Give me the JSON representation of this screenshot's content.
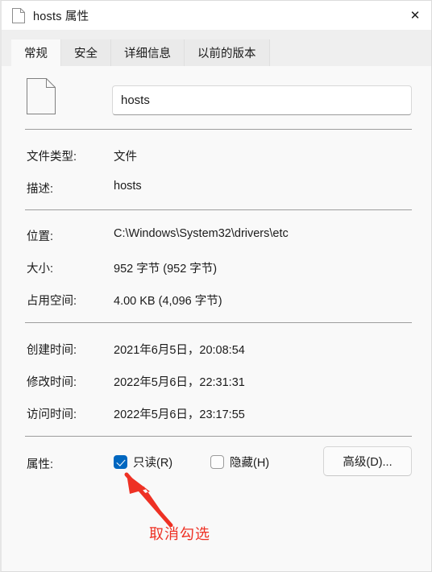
{
  "window": {
    "title": "hosts 属性",
    "title_icon": "file-icon",
    "close_label": "✕",
    "accent_color": "#0067c0",
    "annotation_color": "#ee3124"
  },
  "tabs": [
    {
      "label": "常规",
      "active": true
    },
    {
      "label": "安全",
      "active": false
    },
    {
      "label": "详细信息",
      "active": false
    },
    {
      "label": "以前的版本",
      "active": false
    }
  ],
  "general": {
    "file_icon": "file-icon",
    "name_value": "hosts",
    "name_placeholder": "",
    "rows": [
      {
        "label": "文件类型:",
        "value": "文件"
      },
      {
        "label": "描述:",
        "value": "hosts"
      },
      {
        "label": "位置:",
        "value": "C:\\Windows\\System32\\drivers\\etc"
      },
      {
        "label": "大小:",
        "value": "952 字节 (952 字节)"
      },
      {
        "label": "占用空间:",
        "value": "4.00 KB (4,096 字节)"
      },
      {
        "label": "创建时间:",
        "value": "2021年6月5日，20:08:54"
      },
      {
        "label": "修改时间:",
        "value": "2022年5月6日，22:31:31"
      },
      {
        "label": "访问时间:",
        "value": "2022年5月6日，23:17:55"
      }
    ],
    "attributes": {
      "label": "属性:",
      "readonly_label": "只读(R)",
      "readonly_checked": true,
      "hidden_label": "隐藏(H)",
      "hidden_checked": false,
      "advanced_label": "高级(D)..."
    }
  },
  "annotation": {
    "text": "取消勾选",
    "arrow_icon": "arrow-up-left-icon"
  }
}
